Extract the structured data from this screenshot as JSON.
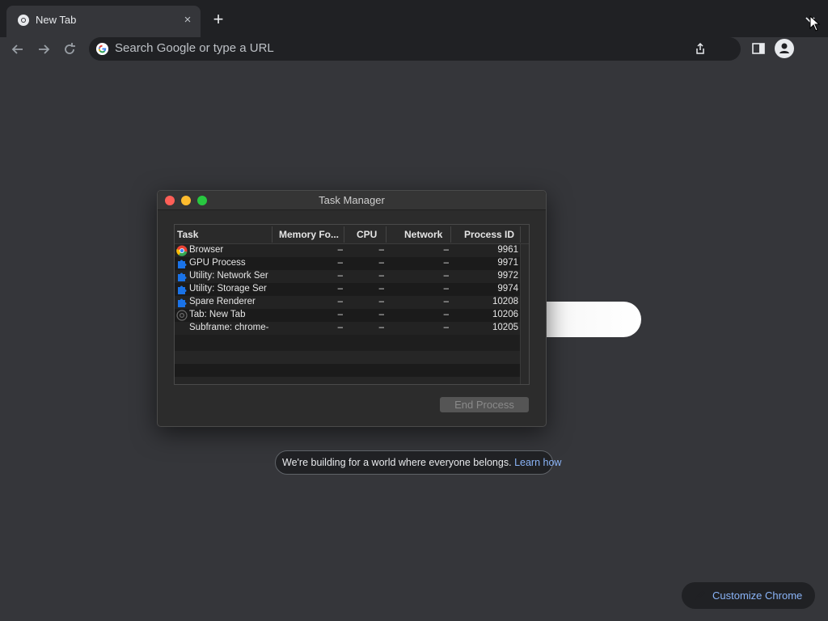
{
  "tab": {
    "title": "New Tab",
    "close": "×"
  },
  "toolbar": {
    "new_tab": "+"
  },
  "omnibox": {
    "placeholder": "Search Google or type a URL"
  },
  "task_manager": {
    "title": "Task Manager",
    "columns": [
      "Task",
      "Memory Fo...",
      "CPU",
      "Network",
      "Process ID"
    ],
    "rows": [
      {
        "icon": "chrome-icon",
        "task": "Browser",
        "memory": "–",
        "cpu": "–",
        "network": "–",
        "pid": "9961"
      },
      {
        "icon": "puzzle-icon",
        "task": "GPU Process",
        "memory": "–",
        "cpu": "–",
        "network": "–",
        "pid": "9971"
      },
      {
        "icon": "puzzle-icon",
        "task": "Utility: Network Ser",
        "memory": "–",
        "cpu": "–",
        "network": "–",
        "pid": "9972"
      },
      {
        "icon": "puzzle-icon",
        "task": "Utility: Storage Ser",
        "memory": "–",
        "cpu": "–",
        "network": "–",
        "pid": "9974"
      },
      {
        "icon": "puzzle-icon",
        "task": "Spare Renderer",
        "memory": "–",
        "cpu": "–",
        "network": "–",
        "pid": "10208"
      },
      {
        "icon": "chrome-gray-icon",
        "task": "Tab: New Tab",
        "memory": "–",
        "cpu": "–",
        "network": "–",
        "pid": "10206"
      },
      {
        "icon": "none",
        "task": "Subframe: chrome-",
        "memory": "–",
        "cpu": "–",
        "network": "–",
        "pid": "10205"
      }
    ],
    "end_process": "End Process"
  },
  "banner": {
    "text": "We're building for a world where everyone belongs.",
    "link": "Learn how"
  },
  "customize": {
    "label": "Customize Chrome"
  },
  "colors": {
    "link": "#8ab4f8",
    "background": "#35363a",
    "tabstrip": "#202124"
  }
}
